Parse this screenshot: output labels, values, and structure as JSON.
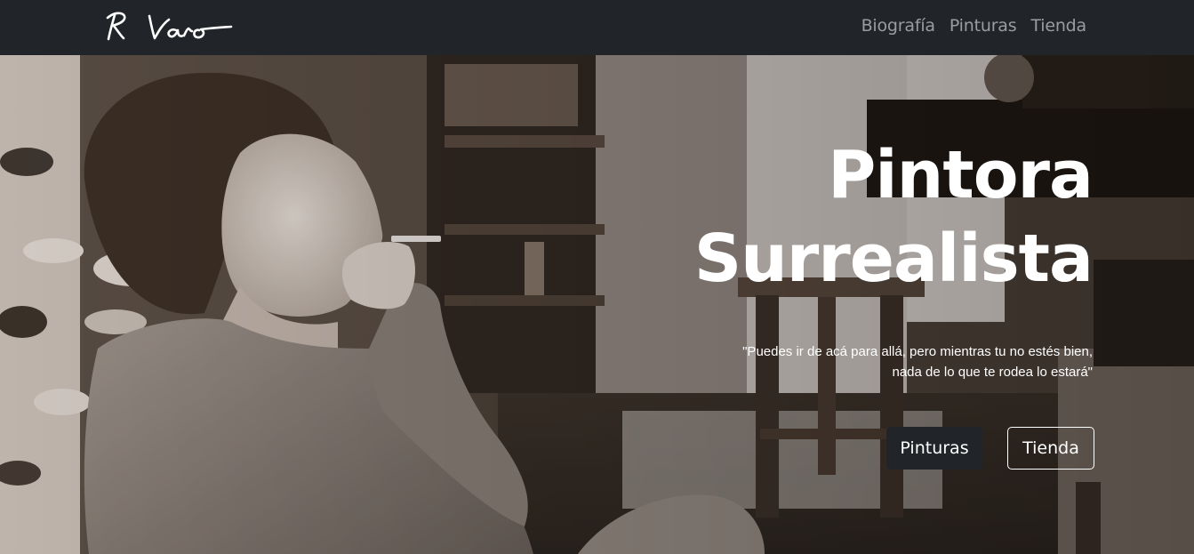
{
  "navbar": {
    "brand_alt": "R Varo",
    "links": [
      {
        "label": "Biografía"
      },
      {
        "label": "Pinturas"
      },
      {
        "label": "Tienda"
      }
    ],
    "background": "#212529",
    "link_color": "#9a9da0"
  },
  "hero": {
    "title_line1": "Pintora",
    "title_line2": "Surrealista",
    "quote_line1": "\"Puedes ir de acá para allá, pero mientras tu no estés bien,",
    "quote_line2": "nada de lo que te rodea lo estará\"",
    "buttons": {
      "primary": "Pinturas",
      "secondary": "Tienda"
    },
    "photo_description": "sepia photograph of a woman smoking",
    "colors": {
      "primary_button": "#212529",
      "text": "#ffffff"
    }
  }
}
